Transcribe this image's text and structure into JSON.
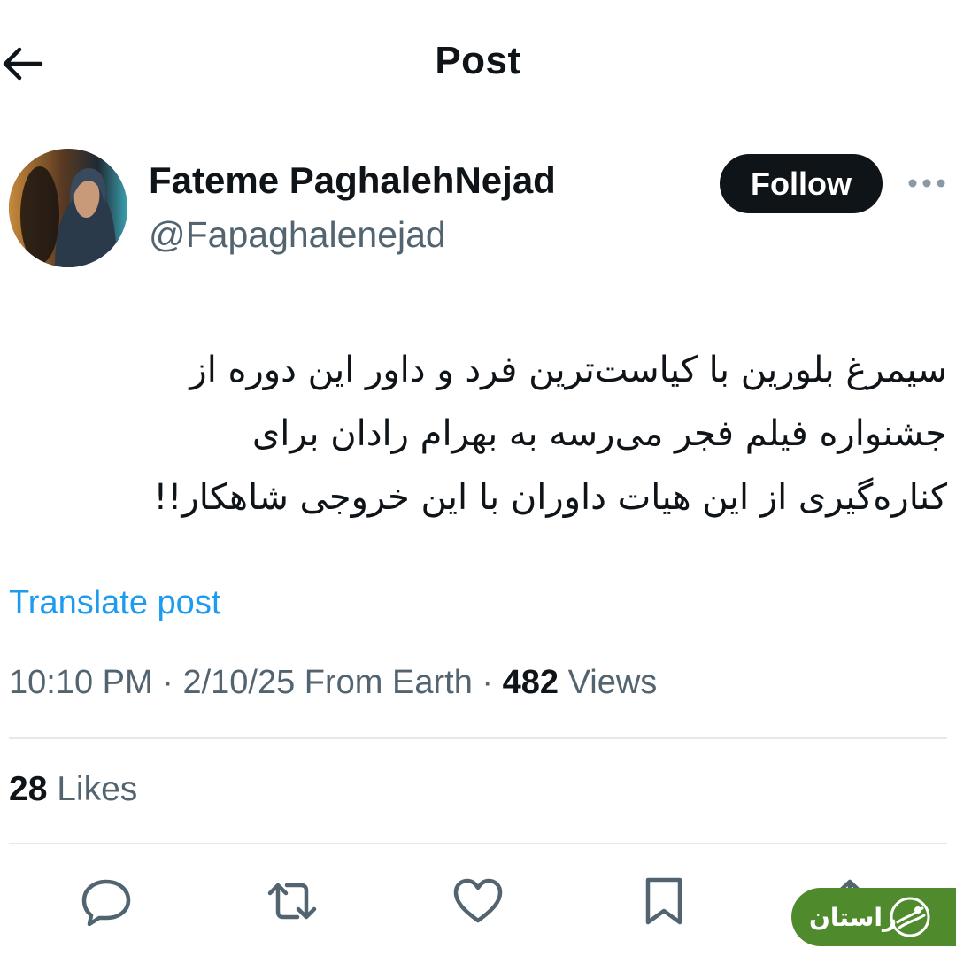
{
  "header": {
    "title": "Post"
  },
  "author": {
    "display_name": "Fateme PaghalehNejad",
    "handle": "@Fapaghalenejad",
    "follow_label": "Follow"
  },
  "post": {
    "lines": [
      "سیمرغ بلورین با کیاست‌ترین فرد و داور این دوره از",
      "جشنواره فیلم فجر می‌رسه به بهرام رادان برای",
      "کناره‌گیری از این هیات داوران با این خروجی شاهکار!!"
    ],
    "translate_label": "Translate post",
    "time": "10:10 PM",
    "date": "2/10/25",
    "source": "From Earth",
    "views_count": "482",
    "views_label": "Views",
    "separator": "·",
    "likes_count": "28",
    "likes_label": "Likes"
  },
  "actions": {
    "icons": [
      "reply-icon",
      "repost-icon",
      "like-icon",
      "bookmark-icon",
      "share-icon"
    ]
  },
  "watermark": {
    "text": "راستان"
  },
  "colors": {
    "text": "#0f1419",
    "muted": "#536471",
    "link": "#1d9bf0",
    "divider": "#e6e9eb",
    "follow_bg": "#0f1419",
    "watermark_bg": "#4f8a2c"
  }
}
